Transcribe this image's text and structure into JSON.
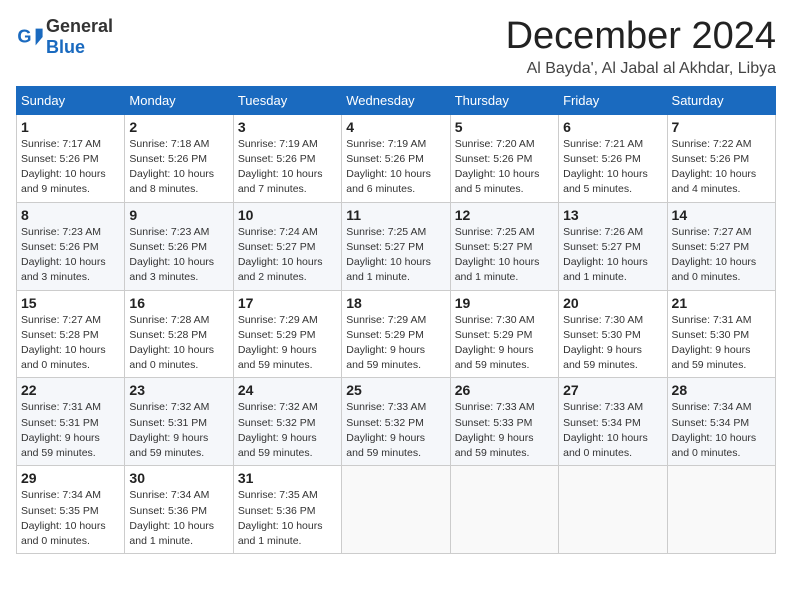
{
  "header": {
    "logo_general": "General",
    "logo_blue": "Blue",
    "month_title": "December 2024",
    "location": "Al Bayda', Al Jabal al Akhdar, Libya"
  },
  "calendar": {
    "days_of_week": [
      "Sunday",
      "Monday",
      "Tuesday",
      "Wednesday",
      "Thursday",
      "Friday",
      "Saturday"
    ],
    "weeks": [
      [
        {
          "day": "",
          "info": ""
        },
        {
          "day": "2",
          "info": "Sunrise: 7:18 AM\nSunset: 5:26 PM\nDaylight: 10 hours\nand 8 minutes."
        },
        {
          "day": "3",
          "info": "Sunrise: 7:19 AM\nSunset: 5:26 PM\nDaylight: 10 hours\nand 7 minutes."
        },
        {
          "day": "4",
          "info": "Sunrise: 7:19 AM\nSunset: 5:26 PM\nDaylight: 10 hours\nand 6 minutes."
        },
        {
          "day": "5",
          "info": "Sunrise: 7:20 AM\nSunset: 5:26 PM\nDaylight: 10 hours\nand 5 minutes."
        },
        {
          "day": "6",
          "info": "Sunrise: 7:21 AM\nSunset: 5:26 PM\nDaylight: 10 hours\nand 5 minutes."
        },
        {
          "day": "7",
          "info": "Sunrise: 7:22 AM\nSunset: 5:26 PM\nDaylight: 10 hours\nand 4 minutes."
        }
      ],
      [
        {
          "day": "1",
          "info": "Sunrise: 7:17 AM\nSunset: 5:26 PM\nDaylight: 10 hours\nand 9 minutes."
        },
        {
          "day": "",
          "info": ""
        },
        {
          "day": "",
          "info": ""
        },
        {
          "day": "",
          "info": ""
        },
        {
          "day": "",
          "info": ""
        },
        {
          "day": "",
          "info": ""
        },
        {
          "day": "",
          "info": ""
        }
      ],
      [
        {
          "day": "8",
          "info": "Sunrise: 7:23 AM\nSunset: 5:26 PM\nDaylight: 10 hours\nand 3 minutes."
        },
        {
          "day": "9",
          "info": "Sunrise: 7:23 AM\nSunset: 5:26 PM\nDaylight: 10 hours\nand 3 minutes."
        },
        {
          "day": "10",
          "info": "Sunrise: 7:24 AM\nSunset: 5:27 PM\nDaylight: 10 hours\nand 2 minutes."
        },
        {
          "day": "11",
          "info": "Sunrise: 7:25 AM\nSunset: 5:27 PM\nDaylight: 10 hours\nand 1 minute."
        },
        {
          "day": "12",
          "info": "Sunrise: 7:25 AM\nSunset: 5:27 PM\nDaylight: 10 hours\nand 1 minute."
        },
        {
          "day": "13",
          "info": "Sunrise: 7:26 AM\nSunset: 5:27 PM\nDaylight: 10 hours\nand 1 minute."
        },
        {
          "day": "14",
          "info": "Sunrise: 7:27 AM\nSunset: 5:27 PM\nDaylight: 10 hours\nand 0 minutes."
        }
      ],
      [
        {
          "day": "15",
          "info": "Sunrise: 7:27 AM\nSunset: 5:28 PM\nDaylight: 10 hours\nand 0 minutes."
        },
        {
          "day": "16",
          "info": "Sunrise: 7:28 AM\nSunset: 5:28 PM\nDaylight: 10 hours\nand 0 minutes."
        },
        {
          "day": "17",
          "info": "Sunrise: 7:29 AM\nSunset: 5:29 PM\nDaylight: 9 hours\nand 59 minutes."
        },
        {
          "day": "18",
          "info": "Sunrise: 7:29 AM\nSunset: 5:29 PM\nDaylight: 9 hours\nand 59 minutes."
        },
        {
          "day": "19",
          "info": "Sunrise: 7:30 AM\nSunset: 5:29 PM\nDaylight: 9 hours\nand 59 minutes."
        },
        {
          "day": "20",
          "info": "Sunrise: 7:30 AM\nSunset: 5:30 PM\nDaylight: 9 hours\nand 59 minutes."
        },
        {
          "day": "21",
          "info": "Sunrise: 7:31 AM\nSunset: 5:30 PM\nDaylight: 9 hours\nand 59 minutes."
        }
      ],
      [
        {
          "day": "22",
          "info": "Sunrise: 7:31 AM\nSunset: 5:31 PM\nDaylight: 9 hours\nand 59 minutes."
        },
        {
          "day": "23",
          "info": "Sunrise: 7:32 AM\nSunset: 5:31 PM\nDaylight: 9 hours\nand 59 minutes."
        },
        {
          "day": "24",
          "info": "Sunrise: 7:32 AM\nSunset: 5:32 PM\nDaylight: 9 hours\nand 59 minutes."
        },
        {
          "day": "25",
          "info": "Sunrise: 7:33 AM\nSunset: 5:32 PM\nDaylight: 9 hours\nand 59 minutes."
        },
        {
          "day": "26",
          "info": "Sunrise: 7:33 AM\nSunset: 5:33 PM\nDaylight: 9 hours\nand 59 minutes."
        },
        {
          "day": "27",
          "info": "Sunrise: 7:33 AM\nSunset: 5:34 PM\nDaylight: 10 hours\nand 0 minutes."
        },
        {
          "day": "28",
          "info": "Sunrise: 7:34 AM\nSunset: 5:34 PM\nDaylight: 10 hours\nand 0 minutes."
        }
      ],
      [
        {
          "day": "29",
          "info": "Sunrise: 7:34 AM\nSunset: 5:35 PM\nDaylight: 10 hours\nand 0 minutes."
        },
        {
          "day": "30",
          "info": "Sunrise: 7:34 AM\nSunset: 5:36 PM\nDaylight: 10 hours\nand 1 minute."
        },
        {
          "day": "31",
          "info": "Sunrise: 7:35 AM\nSunset: 5:36 PM\nDaylight: 10 hours\nand 1 minute."
        },
        {
          "day": "",
          "info": ""
        },
        {
          "day": "",
          "info": ""
        },
        {
          "day": "",
          "info": ""
        },
        {
          "day": "",
          "info": ""
        }
      ]
    ]
  }
}
